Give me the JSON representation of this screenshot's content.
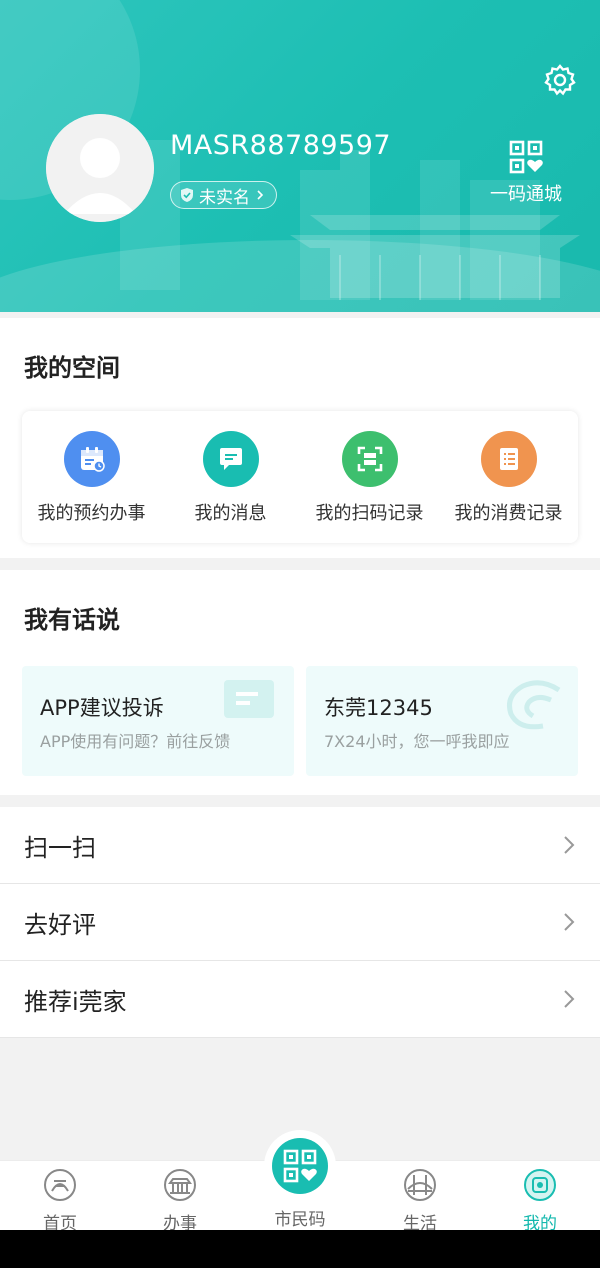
{
  "header": {
    "username": "MASR88789597",
    "verify_status": "未实名",
    "qr_entry_label": "一码通城"
  },
  "my_space": {
    "title": "我的空间",
    "items": [
      {
        "label": "我的预约办事",
        "icon": "calendar-icon",
        "color": "#4f8ff0"
      },
      {
        "label": "我的消息",
        "icon": "message-icon",
        "color": "#19bdb1"
      },
      {
        "label": "我的扫码记录",
        "icon": "scan-icon",
        "color": "#3dbf6e"
      },
      {
        "label": "我的消费记录",
        "icon": "receipt-icon",
        "color": "#f0944f"
      }
    ]
  },
  "feedback": {
    "title": "我有话说",
    "cards": [
      {
        "title": "APP建议投诉",
        "subtitle": "APP使用有问题？前往反馈"
      },
      {
        "title": "东莞12345",
        "subtitle": "7X24小时，您一呼我即应"
      }
    ]
  },
  "menu": {
    "items": [
      {
        "label": "扫一扫"
      },
      {
        "label": "去好评"
      },
      {
        "label": "推荐i莞家"
      }
    ]
  },
  "tabbar": {
    "tabs": [
      {
        "label": "首页"
      },
      {
        "label": "办事"
      },
      {
        "label": "市民码"
      },
      {
        "label": "生活"
      },
      {
        "label": "我的"
      }
    ],
    "active": "我的"
  },
  "colors": {
    "accent": "#19bdb1"
  }
}
